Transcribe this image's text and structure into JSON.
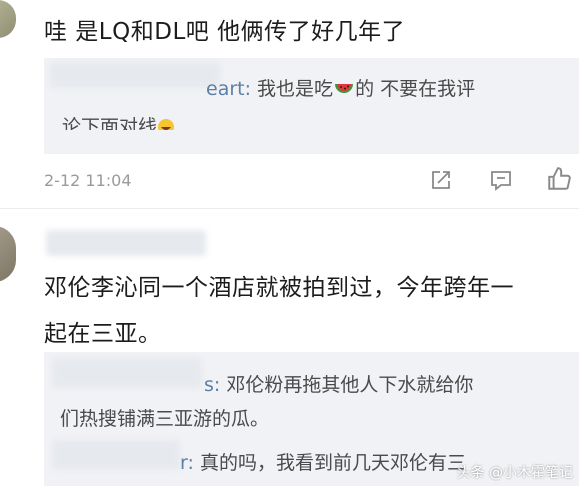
{
  "comments": [
    {
      "text": "哇 是LQ和DL吧 他俩传了好几年了",
      "reply": {
        "name_tail": "eart:",
        "line1": "我也是吃",
        "line1_after": "的 不要在我评",
        "line2": "论下面对线"
      },
      "timestamp": "2-12 11:04"
    },
    {
      "text_line1": "邓伦李沁同一个酒店就被拍到过，今年跨年一",
      "text_line2": "起在三亚。",
      "replies": [
        {
          "tail": "s:",
          "line1": "邓伦粉再拖其他人下水就给你",
          "line2": "们热搜铺满三亚游的瓜。"
        },
        {
          "tail": "r:",
          "line1": "真的吗，我看到前几天邓伦有三"
        }
      ]
    }
  ],
  "watermark": "头条 @小木霍笔记",
  "icons": [
    "share-icon",
    "comment-icon",
    "like-icon",
    "watermelon-emoji-icon",
    "laugh-emoji-icon"
  ]
}
